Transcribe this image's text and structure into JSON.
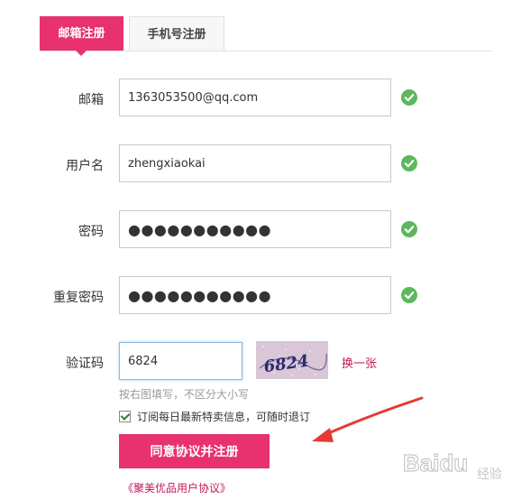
{
  "tabs": [
    {
      "label": "邮箱注册",
      "active": true
    },
    {
      "label": "手机号注册",
      "active": false
    }
  ],
  "form": {
    "email": {
      "label": "邮箱",
      "value": "1363053500@qq.com"
    },
    "username": {
      "label": "用户名",
      "value": "zhengxiaokai"
    },
    "password": {
      "label": "密码",
      "value": "●●●●●●●●●●●"
    },
    "confirm_password": {
      "label": "重复密码",
      "value": "●●●●●●●●●●●"
    },
    "captcha": {
      "label": "验证码",
      "value": "6824",
      "image_text": "6824"
    }
  },
  "captcha_refresh_label": "换一张",
  "captcha_hint": "按右图填写，不区分大小写",
  "subscribe": {
    "label": "订阅每日最新特卖信息，可随时退订",
    "checked": true
  },
  "submit_label": "同意协议并注册",
  "agreement_link": "《聚美优品用户协议》",
  "watermark": {
    "brand": "Baidu",
    "sub": "经验"
  },
  "colors": {
    "accent": "#e8316f",
    "valid": "#5cb85c",
    "link": "#c2185b",
    "arrow": "#e53935"
  },
  "icons": {
    "validation": "check-circle-icon",
    "annotation": "red-arrow"
  }
}
